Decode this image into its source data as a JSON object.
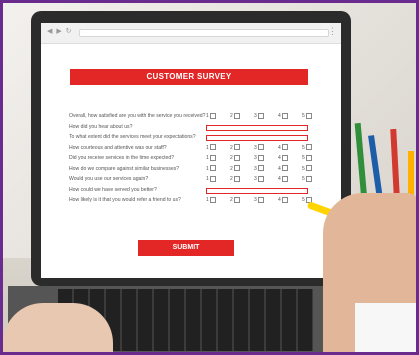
{
  "survey": {
    "title": "CUSTOMER SURVEY",
    "submit_label": "SUBMIT",
    "questions": [
      {
        "text": "Overall, how satisfied are you with the service you received?",
        "type": "scale"
      },
      {
        "text": "How did you hear about us?",
        "type": "text"
      },
      {
        "text": "To what extent did the services meet your expectations?",
        "type": "text"
      },
      {
        "text": "How courteous and attentive was our staff?",
        "type": "scale"
      },
      {
        "text": "Did you receive services in the time expected?",
        "type": "scale"
      },
      {
        "text": "How do we compare against similar businesses?",
        "type": "scale"
      },
      {
        "text": "Would you use our services again?",
        "type": "scale"
      },
      {
        "text": "How could we have served you better?",
        "type": "text"
      },
      {
        "text": "How likely is it that you would refer a friend to us?",
        "type": "scale"
      }
    ],
    "scale_options": [
      "1",
      "2",
      "3",
      "4",
      "5"
    ]
  }
}
